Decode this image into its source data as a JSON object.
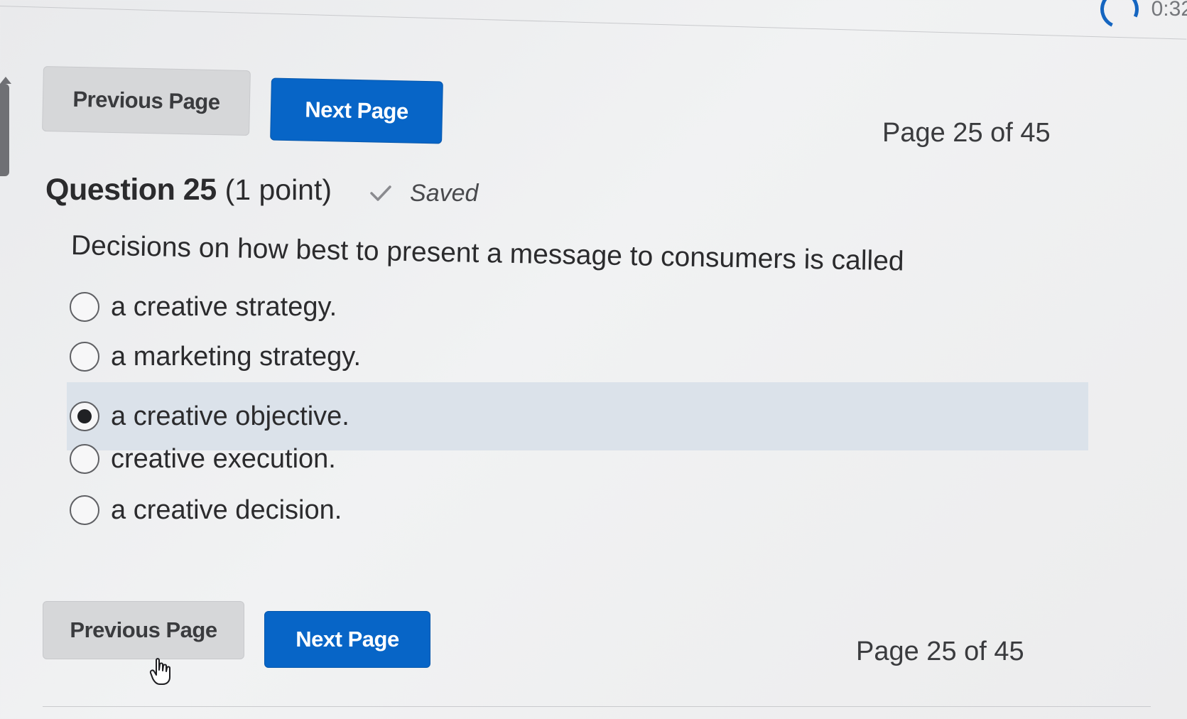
{
  "timer": {
    "text": "0:32"
  },
  "top_nav": {
    "previous_label": "Previous Page",
    "next_label": "Next Page",
    "page_counter": "Page 25 of 45"
  },
  "question": {
    "title": "Question 25",
    "points": "(1 point)",
    "status": "Saved",
    "status_icon": "checkmark-icon",
    "text": "Decisions on how best to present a message to consumers is called",
    "options": [
      {
        "label": "a creative strategy.",
        "selected": false
      },
      {
        "label": "a marketing strategy.",
        "selected": false
      },
      {
        "label": "a creative objective.",
        "selected": true
      },
      {
        "label": "creative execution.",
        "selected": false
      },
      {
        "label": "a creative decision.",
        "selected": false
      }
    ]
  },
  "bottom_nav": {
    "previous_label": "Previous Page",
    "next_label": "Next Page",
    "page_counter": "Page 25 of 45"
  },
  "colors": {
    "primary_button": "#0765c7",
    "secondary_button": "#d6d7d9",
    "selected_row": "#dbe2ea",
    "timer_ring": "#1565c0"
  }
}
